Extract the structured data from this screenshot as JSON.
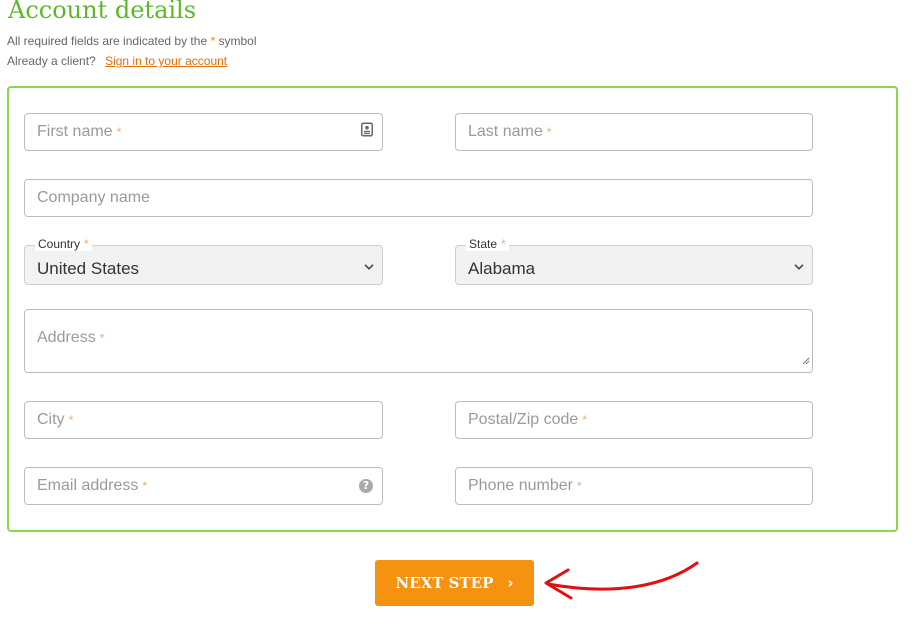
{
  "header": {
    "title": "Account details",
    "required_note_prefix": "All required fields are indicated by the",
    "required_symbol": "*",
    "required_note_suffix": "symbol",
    "client_prompt": "Already a client?",
    "sign_in_link": "Sign in to your account"
  },
  "form": {
    "first_name": {
      "placeholder": "First name",
      "required": "*"
    },
    "last_name": {
      "placeholder": "Last name",
      "required": "*"
    },
    "company": {
      "placeholder": "Company name"
    },
    "country": {
      "label": "Country",
      "required": "*",
      "value": "United States"
    },
    "state": {
      "label": "State",
      "required": "*",
      "value": "Alabama"
    },
    "address": {
      "placeholder": "Address",
      "required": "*"
    },
    "city": {
      "placeholder": "City",
      "required": "*"
    },
    "postal": {
      "placeholder": "Postal/Zip code",
      "required": "*"
    },
    "email": {
      "placeholder": "Email address",
      "required": "*",
      "help_glyph": "?"
    },
    "phone": {
      "placeholder": "Phone number",
      "required": "*"
    }
  },
  "actions": {
    "next_label": "NEXT STEP",
    "next_chevron": "›"
  },
  "icons": {
    "contact_card": "contact-card-icon",
    "help": "help-icon",
    "select_chevron": "chevron-down-icon",
    "annotation": "red-arrow-annotation"
  },
  "colors": {
    "title": "#5cb82a",
    "panel_border": "#8bd64a",
    "button": "#f5920f",
    "required_star": "#f6a96a",
    "link": "#e0700a",
    "annotation_arrow": "#e01010"
  }
}
